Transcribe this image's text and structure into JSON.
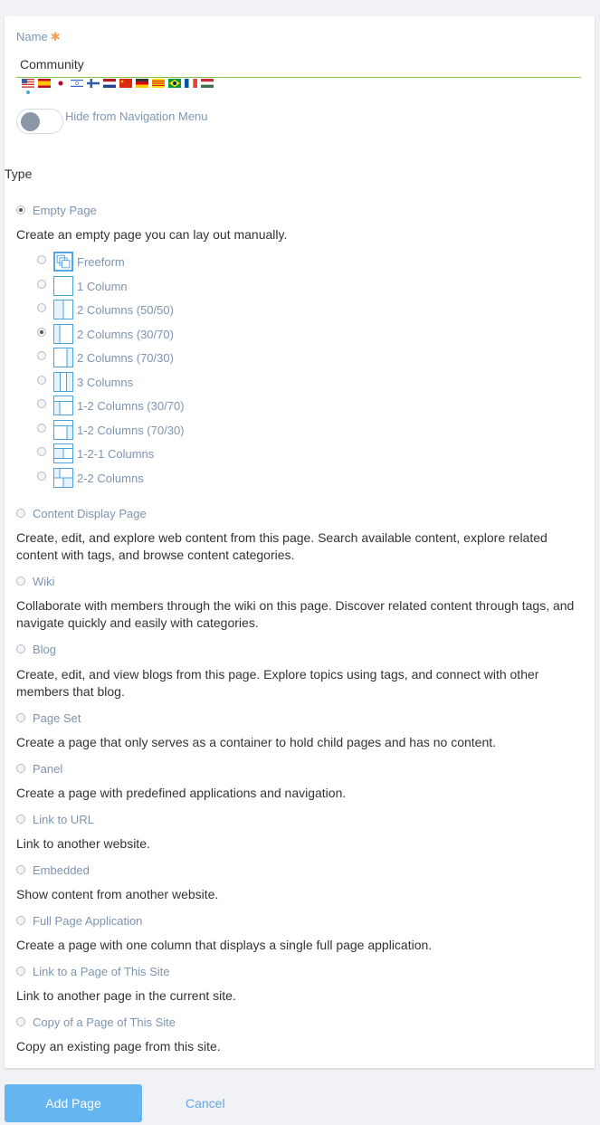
{
  "form": {
    "name_label": "Name",
    "required_mark": "✱",
    "name_value": "Community",
    "flags": [
      "en-US",
      "es-ES",
      "ja-JP",
      "he-IL",
      "fi-FI",
      "nl-NL",
      "zh-CN",
      "de-DE",
      "ca-ES",
      "pt-BR",
      "fr-FR",
      "hu-HU"
    ],
    "hide_toggle_label": "Hide from Navigation Menu",
    "hide_toggle_on": false,
    "type_label": "Type"
  },
  "types": [
    {
      "label": "Empty Page",
      "desc": "Create an empty page you can lay out manually.",
      "checked": true
    },
    {
      "label": "Content Display Page",
      "desc": "Create, edit, and explore web content from this page. Search available content, explore related content with tags, and browse content categories.",
      "checked": false
    },
    {
      "label": "Wiki",
      "desc": "Collaborate with members through the wiki on this page. Discover related content through tags, and navigate quickly and easily with categories.",
      "checked": false
    },
    {
      "label": "Blog",
      "desc": "Create, edit, and view blogs from this page. Explore topics using tags, and connect with other members that blog.",
      "checked": false
    },
    {
      "label": "Page Set",
      "desc": "Create a page that only serves as a container to hold child pages and has no content.",
      "checked": false
    },
    {
      "label": "Panel",
      "desc": "Create a page with predefined applications and navigation.",
      "checked": false
    },
    {
      "label": "Link to URL",
      "desc": "Link to another website.",
      "checked": false
    },
    {
      "label": "Embedded",
      "desc": "Show content from another website.",
      "checked": false
    },
    {
      "label": "Full Page Application",
      "desc": "Create a page with one column that displays a single full page application.",
      "checked": false
    },
    {
      "label": "Link to a Page of This Site",
      "desc": "Link to another page in the current site.",
      "checked": false
    },
    {
      "label": "Copy of a Page of This Site",
      "desc": "Copy an existing page from this site.",
      "checked": false
    }
  ],
  "layouts": [
    {
      "label": "Freeform",
      "icon": "freeform-layout-icon",
      "checked": false
    },
    {
      "label": "1 Column",
      "icon": "one-column-layout-icon",
      "checked": false
    },
    {
      "label": "2 Columns (50/50)",
      "icon": "two-columns-50-50-layout-icon",
      "checked": false
    },
    {
      "label": "2 Columns (30/70)",
      "icon": "two-columns-30-70-layout-icon",
      "checked": true
    },
    {
      "label": "2 Columns (70/30)",
      "icon": "two-columns-70-30-layout-icon",
      "checked": false
    },
    {
      "label": "3 Columns",
      "icon": "three-columns-layout-icon",
      "checked": false
    },
    {
      "label": "1-2 Columns (30/70)",
      "icon": "one-two-columns-30-70-layout-icon",
      "checked": false
    },
    {
      "label": "1-2 Columns (70/30)",
      "icon": "one-two-columns-70-30-layout-icon",
      "checked": false
    },
    {
      "label": "1-2-1 Columns",
      "icon": "one-two-one-columns-layout-icon",
      "checked": false
    },
    {
      "label": "2-2 Columns",
      "icon": "two-two-columns-layout-icon",
      "checked": false
    }
  ],
  "buttons": {
    "add_label": "Add Page",
    "cancel_label": "Cancel"
  },
  "colors": {
    "accent": "#65b6f0",
    "label": "#7c95b0",
    "input_underline": "#8bc34a",
    "layout_line": "#4aa3df"
  }
}
